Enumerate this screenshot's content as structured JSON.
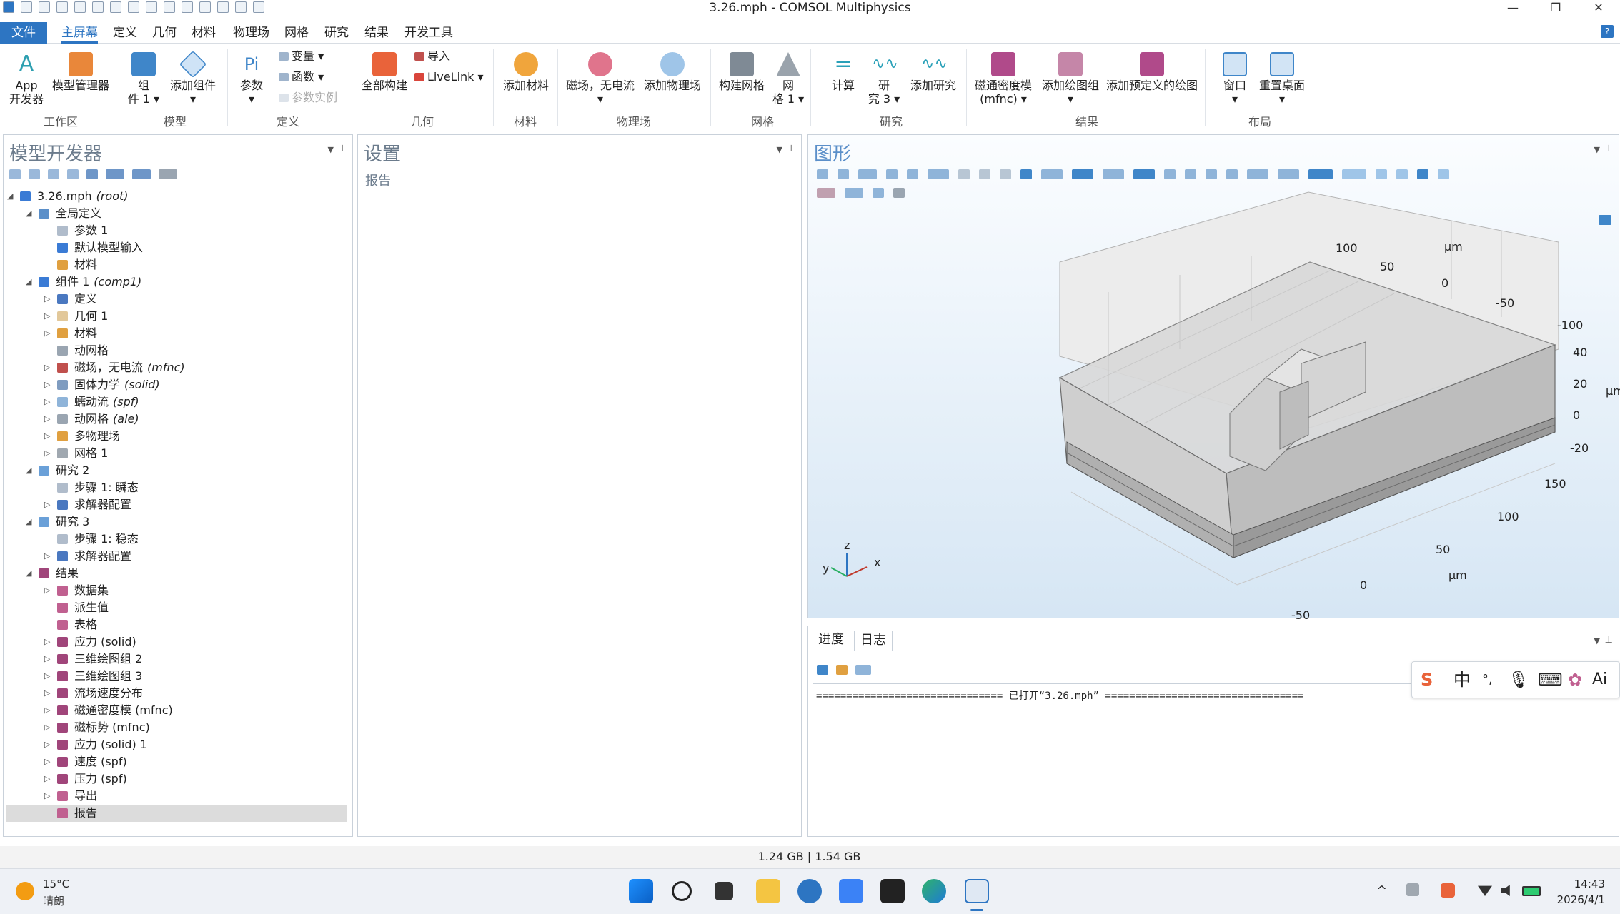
{
  "window": {
    "title": "3.26.mph - COMSOL Multiphysics",
    "min": "—",
    "max": "❐",
    "close": "✕"
  },
  "menu": {
    "file": "文件",
    "items": [
      "主屏幕",
      "定义",
      "几何",
      "材料",
      "物理场",
      "网格",
      "研究",
      "结果",
      "开发工具"
    ],
    "help": "?"
  },
  "ribbon": {
    "app_builder": "App\n开发器",
    "model_manager": "模型管理器",
    "component": "组\n件 1 ▾",
    "add_component": "添加组件\n▾",
    "parameters": "参数\n▾",
    "variables": "变量 ▾",
    "functions": "函数 ▾",
    "param_case": "参数实例",
    "build_all": "全部构建",
    "import": "导入",
    "livelink": "LiveLink ▾",
    "add_material": "添加材料",
    "physics_mf": "磁场，无电流\n▾",
    "add_physics": "添加物理场",
    "build_mesh": "构建网格",
    "mesh1": "网\n格 1 ▾",
    "compute": "计算",
    "study3": "研\n究 3 ▾",
    "add_study": "添加研究",
    "flux_density": "磁通密度模\n(mfnc) ▾",
    "add_plot_group": "添加绘图组\n▾",
    "add_predef_plot": "添加预定义的绘图",
    "windows": "窗口\n▾",
    "reset_desktop": "重置桌面\n▾",
    "groups": [
      "工作区",
      "模型",
      "定义",
      "几何",
      "材料",
      "物理场",
      "网格",
      "研究",
      "结果",
      "布局"
    ]
  },
  "model_builder": {
    "title": "模型开发器",
    "tree": [
      {
        "label": "3.26.mph",
        "suffix": "(root)",
        "level": 0,
        "exp": "◢",
        "icon": "#3a7bd5"
      },
      {
        "label": "全局定义",
        "level": 1,
        "exp": "◢",
        "icon": "#5b8fc9"
      },
      {
        "label": "参数 1",
        "level": 2,
        "exp": "",
        "icon": "#b0bccb"
      },
      {
        "label": "默认模型输入",
        "level": 2,
        "exp": "",
        "icon": "#3a7bd5"
      },
      {
        "label": "材料",
        "level": 2,
        "exp": "",
        "icon": "#e0a040"
      },
      {
        "label": "组件 1",
        "suffix": "(comp1)",
        "level": 1,
        "exp": "◢",
        "icon": "#3a7bd5"
      },
      {
        "label": "定义",
        "level": 2,
        "exp": "▷",
        "icon": "#4a78c0"
      },
      {
        "label": "几何 1",
        "level": 2,
        "exp": "▷",
        "icon": "#e2c89a"
      },
      {
        "label": "材料",
        "level": 2,
        "exp": "▷",
        "icon": "#e0a040"
      },
      {
        "label": "动网格",
        "level": 2,
        "exp": "",
        "icon": "#9aa5b1"
      },
      {
        "label": "磁场，无电流",
        "suffix": "(mfnc)",
        "level": 2,
        "exp": "▷",
        "icon": "#c0504d"
      },
      {
        "label": "固体力学",
        "suffix": "(solid)",
        "level": 2,
        "exp": "▷",
        "icon": "#7f9cc0"
      },
      {
        "label": "蠕动流",
        "suffix": "(spf)",
        "level": 2,
        "exp": "▷",
        "icon": "#8fb4d9"
      },
      {
        "label": "动网格",
        "suffix": "(ale)",
        "level": 2,
        "exp": "▷",
        "icon": "#9aa5b1"
      },
      {
        "label": "多物理场",
        "level": 2,
        "exp": "▷",
        "icon": "#e0a040"
      },
      {
        "label": "网格 1",
        "level": 2,
        "exp": "▷",
        "icon": "#a0a8b0"
      },
      {
        "label": "研究 2",
        "level": 1,
        "exp": "◢",
        "icon": "#6aa0d8"
      },
      {
        "label": "步骤 1: 瞬态",
        "level": 2,
        "exp": "",
        "icon": "#b0bccb"
      },
      {
        "label": "求解器配置",
        "level": 2,
        "exp": "▷",
        "icon": "#4a78c0"
      },
      {
        "label": "研究 3",
        "level": 1,
        "exp": "◢",
        "icon": "#6aa0d8"
      },
      {
        "label": "步骤 1: 稳态",
        "level": 2,
        "exp": "",
        "icon": "#b0bccb"
      },
      {
        "label": "求解器配置",
        "level": 2,
        "exp": "▷",
        "icon": "#4a78c0"
      },
      {
        "label": "结果",
        "level": 1,
        "exp": "◢",
        "icon": "#a0457a"
      },
      {
        "label": "数据集",
        "level": 2,
        "exp": "▷",
        "icon": "#c06090"
      },
      {
        "label": "派生值",
        "level": 2,
        "exp": "",
        "icon": "#c06090"
      },
      {
        "label": "表格",
        "level": 2,
        "exp": "",
        "icon": "#c06090"
      },
      {
        "label": "应力 (solid)",
        "level": 2,
        "exp": "▷",
        "icon": "#a0457a"
      },
      {
        "label": "三维绘图组 2",
        "level": 2,
        "exp": "▷",
        "icon": "#a0457a"
      },
      {
        "label": "三维绘图组 3",
        "level": 2,
        "exp": "▷",
        "icon": "#a0457a"
      },
      {
        "label": "流场速度分布",
        "level": 2,
        "exp": "▷",
        "icon": "#a0457a"
      },
      {
        "label": "磁通密度模 (mfnc)",
        "level": 2,
        "exp": "▷",
        "icon": "#a0457a"
      },
      {
        "label": "磁标势 (mfnc)",
        "level": 2,
        "exp": "▷",
        "icon": "#a0457a"
      },
      {
        "label": "应力 (solid) 1",
        "level": 2,
        "exp": "▷",
        "icon": "#a0457a"
      },
      {
        "label": "速度 (spf)",
        "level": 2,
        "exp": "▷",
        "icon": "#a0457a"
      },
      {
        "label": "压力 (spf)",
        "level": 2,
        "exp": "▷",
        "icon": "#a0457a"
      },
      {
        "label": "导出",
        "level": 2,
        "exp": "▷",
        "icon": "#c06090"
      },
      {
        "label": "报告",
        "level": 2,
        "exp": "",
        "icon": "#c06090",
        "selected": true
      }
    ]
  },
  "settings": {
    "title": "设置",
    "subtitle": "报告"
  },
  "graphics": {
    "title": "图形",
    "axis_unit": "µm",
    "ticks_top": [
      "100",
      "50",
      "0",
      "-50",
      "-100"
    ],
    "ticks_right": [
      "40",
      "20",
      "0",
      "-20"
    ],
    "ticks_bottom": [
      "150",
      "100",
      "50",
      "0",
      "-50"
    ],
    "triad": {
      "x": "x",
      "y": "y",
      "z": "z"
    }
  },
  "log": {
    "tabs": [
      "进度",
      "日志"
    ],
    "line": "=============================== 已打开“3.26.mph” ================================="
  },
  "ime": [
    "S",
    "中",
    "°,",
    "🎙",
    "⌨",
    "✿",
    "Ai"
  ],
  "status": {
    "memory": "1.24 GB | 1.54 GB"
  },
  "taskbar": {
    "temp": "15°C",
    "weather": "晴朗",
    "time": "14:43",
    "date": "2026/4/1"
  }
}
